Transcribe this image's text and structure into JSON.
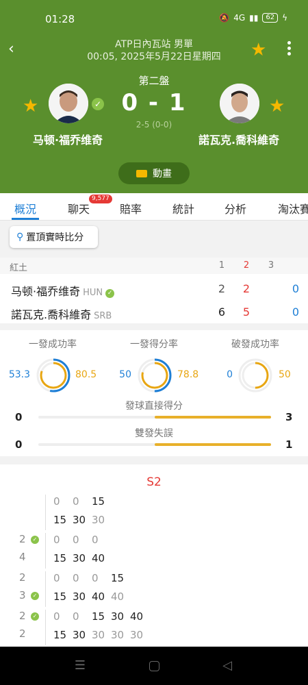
{
  "status_bar": {
    "time": "01:28",
    "battery": "62",
    "signal_text": "4G"
  },
  "header": {
    "tournament": "ATP日內瓦站 男單",
    "datetime": "00:05, 2025年5月22日星期四",
    "set_label": "第二盤",
    "score": "0 - 1",
    "game_score": "2-5 (0-0)",
    "animation_label": "動畫"
  },
  "players": {
    "home": {
      "name": "马顿·福乔维奇",
      "country": "HUN",
      "flag_color": "#ffffff"
    },
    "away": {
      "name": "諾瓦克.喬科維奇",
      "country": "SRB"
    }
  },
  "tabs": {
    "items": [
      {
        "label": "概況"
      },
      {
        "label": "聊天"
      },
      {
        "label": "賠率"
      },
      {
        "label": "統計"
      },
      {
        "label": "分析"
      },
      {
        "label": "淘汰賽"
      }
    ],
    "chat_badge": "9,577"
  },
  "pin_button": {
    "label": "置頂實時比分"
  },
  "score_table": {
    "surface": "紅土",
    "columns": [
      "1",
      "2",
      "3"
    ],
    "rows": [
      {
        "name": "马顿·福乔维奇",
        "country": "HUN",
        "s1": "2",
        "s2": "2",
        "s3": "0"
      },
      {
        "name": "諾瓦克.喬科維奇",
        "country": "SRB",
        "s1": "6",
        "s2": "5",
        "s3": "0"
      }
    ]
  },
  "stats": {
    "first_serve_in": {
      "title": "一發成功率",
      "home": "53.3",
      "away": "80.5",
      "home_pct": 53.3,
      "away_pct": 80.5
    },
    "first_serve_won": {
      "title": "一發得分率",
      "home": "50",
      "away": "78.8",
      "home_pct": 50,
      "away_pct": 78.8
    },
    "break_points": {
      "title": "破發成功率",
      "home": "0",
      "away": "50",
      "home_pct": 0,
      "away_pct": 50
    },
    "aces": {
      "title": "發球直接得分",
      "home": "0",
      "away": "3"
    },
    "double_faults": {
      "title": "雙發失誤",
      "home": "0",
      "away": "1"
    }
  },
  "colors": {
    "header_green": "#5a8f2d",
    "home_blue": "#1e7fd6",
    "away_gold": "#e8a612",
    "accent_red": "#e53935"
  },
  "point_by_point": {
    "set_title": "S2",
    "games": [
      {
        "side_top": "",
        "side_bottom": "",
        "check": "",
        "top": [
          "0",
          "0",
          "15"
        ],
        "bottom": [
          "15",
          "30",
          "30"
        ]
      },
      {
        "side_top": "2",
        "side_bottom": "4",
        "check": "top",
        "top": [
          "0",
          "0",
          "0"
        ],
        "bottom": [
          "15",
          "30",
          "40"
        ]
      },
      {
        "side_top": "2",
        "side_bottom": "3",
        "check": "bottom",
        "top": [
          "0",
          "0",
          "0",
          "15"
        ],
        "bottom": [
          "15",
          "30",
          "40",
          "40"
        ]
      },
      {
        "side_top": "2",
        "side_bottom": "2",
        "check": "top",
        "top": [
          "0",
          "0",
          "15",
          "30",
          "40"
        ],
        "bottom": [
          "15",
          "30",
          "30",
          "30",
          "30"
        ]
      }
    ]
  }
}
